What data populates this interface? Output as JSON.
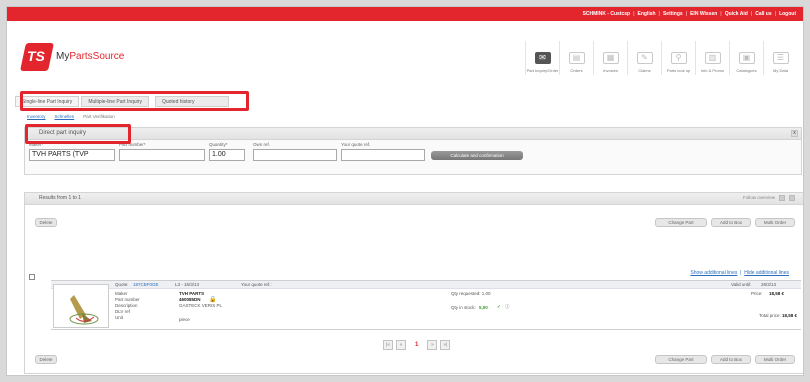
{
  "topbar": {
    "items": [
      "SCHMINK - Custcsp",
      "English",
      "Settings",
      "EIN Wissen",
      "Quick Aid",
      "Call us",
      "Logout"
    ]
  },
  "brand": {
    "logo_mark": "TS",
    "name_prefix": "My",
    "name_main": "PartsSource"
  },
  "toolbar": {
    "items": [
      {
        "label": "Part Inquiry/Order",
        "icon": "envelope-icon"
      },
      {
        "label": "Orders",
        "icon": "orders-icon"
      },
      {
        "label": "Invoices",
        "icon": "invoices-icon"
      },
      {
        "label": "Claims",
        "icon": "claims-icon"
      },
      {
        "label": "Parts look up",
        "icon": "search-icon"
      },
      {
        "label": "Info & Promo",
        "icon": "chart-icon"
      },
      {
        "label": "Catalogues",
        "icon": "catalogue-icon"
      },
      {
        "label": "My Data",
        "icon": "mydata-icon"
      }
    ]
  },
  "tabs": [
    "Single-line Part Inquiry",
    "Multiple-line Part Inquiry",
    "Quoted history"
  ],
  "subnav": [
    "Inventory",
    "Schnellen",
    "Part Verifikation"
  ],
  "inquiry_panel": {
    "title": "Direct part inquiry",
    "close": "x",
    "fields": {
      "maker_label": "Maker*",
      "maker_value": "TVH PARTS (TVP",
      "part_label": "Part number*",
      "part_value": "",
      "qty_label": "Quantity*",
      "qty_value": "1.00",
      "own_ref_label": "Own ref.",
      "own_ref_value": "",
      "quote_ref_label": "Your quote ref.",
      "quote_ref_value": ""
    },
    "submit_label": "Calculate and confirmation"
  },
  "results_panel": {
    "title": "Results from 1 to 1",
    "right_label": "Follow overview",
    "top_left_button": "Delete",
    "right_buttons": [
      "Change Part",
      "Add to Box",
      "Multi Order"
    ],
    "links": [
      "Show additional lines",
      "Hide additional lines"
    ],
    "row": {
      "quote_label": "Quote:",
      "quote_value": "187CBF0GE",
      "line_value": "L3 - 15/3/13",
      "your_ref_label": "Your quote ref.:",
      "valid_label": "Valid until:",
      "valid_value": "28/3/13",
      "maker_label": "Maker",
      "maker_value": "TVH PARTS",
      "part_label": "Part number",
      "part_value": "460085DN",
      "desc_label": "Description",
      "desc_value": "GASTECK VERIS PL",
      "dlv_label": "DLV ref",
      "unit_label": "Unit",
      "unit_value": "piece",
      "qty_requested": "Qty requested: 1.00",
      "qty_stock_label": "Qty in stock:",
      "qty_stock_value": "5,00",
      "price_label": "Price:",
      "price_value": "18,58 €"
    },
    "total_label": "Total price:",
    "total_value": "18,58 €",
    "pager": {
      "prev_first": "|«",
      "prev": "«",
      "current": "1",
      "next": "»",
      "next_last": "»|"
    },
    "bottom_left_button": "Delete",
    "bottom_right_buttons": [
      "Change Part",
      "Add to Box",
      "Multi Order"
    ]
  }
}
